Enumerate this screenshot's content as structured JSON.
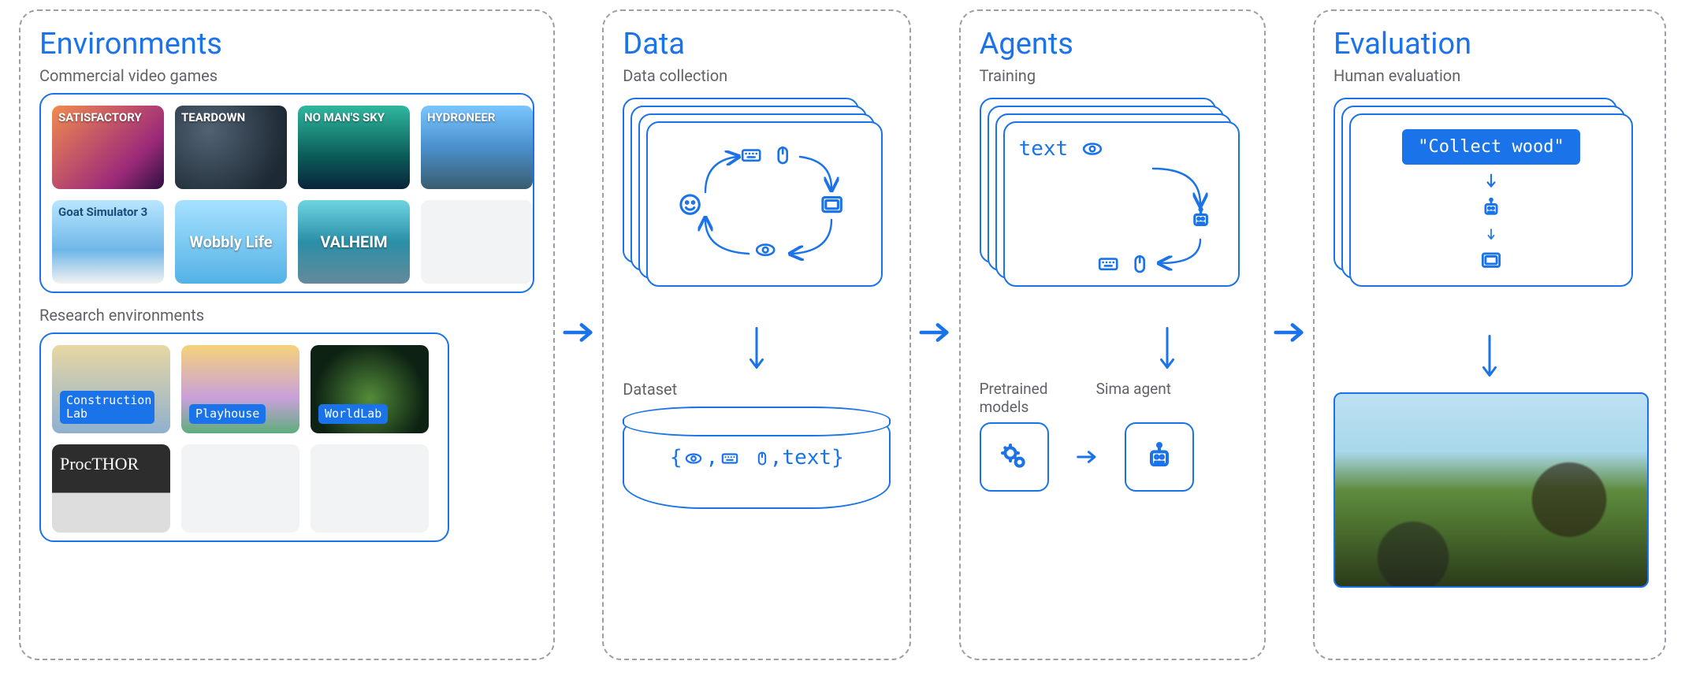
{
  "panels": {
    "environments": {
      "title": "Environments",
      "sections": {
        "commercial": {
          "label": "Commercial video games",
          "games": [
            "SATISFACTORY",
            "TEARDOWN",
            "NO MAN'S SKY",
            "HYDRONEER",
            "Goat Simulator 3",
            "Wobbly Life",
            "VALHEIM"
          ]
        },
        "research": {
          "label": "Research environments",
          "envs": [
            "Construction Lab",
            "Playhouse",
            "WorldLab",
            "ProcTHOR"
          ]
        }
      }
    },
    "data": {
      "title": "Data",
      "collection_label": "Data collection",
      "dataset_label": "Dataset",
      "dataset_content": {
        "prefix": "{",
        "mid1": ",",
        "mid2": ",",
        "text_token": "text",
        "suffix": "}"
      }
    },
    "agents": {
      "title": "Agents",
      "training_label": "Training",
      "input_text": "text",
      "pretrained_label": "Pretrained models",
      "sima_label": "Sima agent"
    },
    "evaluation": {
      "title": "Evaluation",
      "human_label": "Human evaluation",
      "task": "\"Collect wood\""
    }
  },
  "icons": {
    "eye": "eye-icon",
    "keyboard": "keyboard-icon",
    "mouse": "mouse-icon",
    "gamepad": "gamepad-icon",
    "person": "person-icon",
    "robot": "robot-icon",
    "gears": "gears-icon",
    "arrow": "arrow-icon"
  }
}
